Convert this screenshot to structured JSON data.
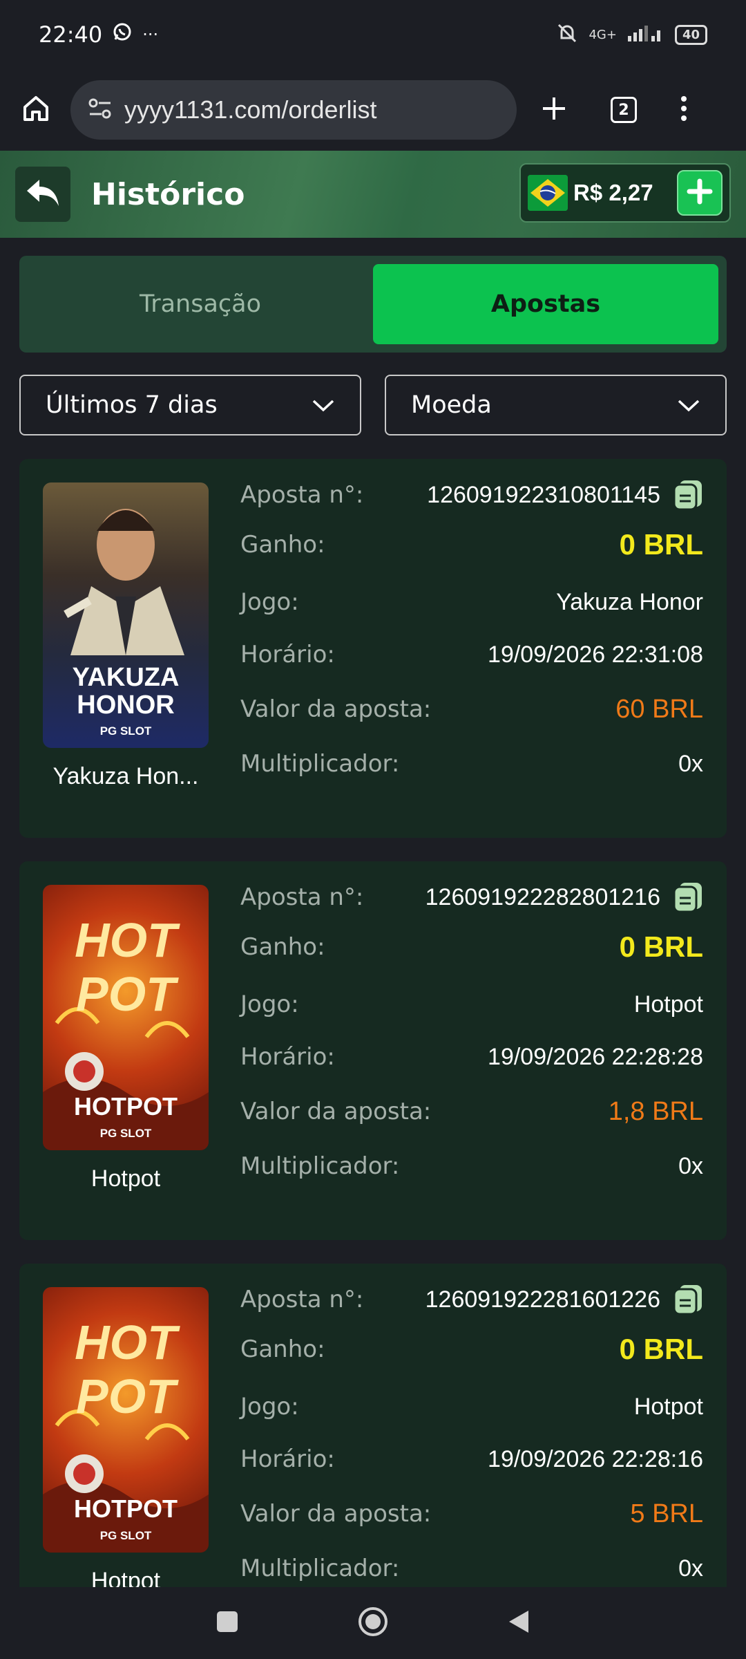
{
  "status_bar": {
    "time": "22:40",
    "more": "···",
    "network": "4G+",
    "battery": "40"
  },
  "browser": {
    "url": "yyyy1131.com/orderlist",
    "tab_count": "2"
  },
  "header": {
    "title": "Histórico",
    "balance": "R$ 2,27"
  },
  "tabs": [
    {
      "label": "Transação",
      "active": false
    },
    {
      "label": "Apostas",
      "active": true
    }
  ],
  "filters": {
    "period": "Últimos 7 dias",
    "currency": "Moeda"
  },
  "labels": {
    "bet_no": "Aposta n°:",
    "win": "Ganho:",
    "game": "Jogo:",
    "time": "Horário:",
    "bet_value": "Valor da aposta:",
    "multiplier": "Multiplicador:"
  },
  "bets": [
    {
      "thumb_title_1": "YAKUZA",
      "thumb_title_2": "HONOR",
      "thumb_brand": "PG SLOT",
      "caption": "Yakuza Hon...",
      "bet_no": "126091922310801145",
      "win": "0 BRL",
      "game": "Yakuza Honor",
      "time": "19/09/2026 22:31:08",
      "bet_value": "60 BRL",
      "multiplier": "0x"
    },
    {
      "thumb_title_1": "HOT",
      "thumb_title_2": "POT",
      "thumb_logo": "HOTPOT",
      "thumb_brand": "PG SLOT",
      "caption": "Hotpot",
      "bet_no": "126091922282801216",
      "win": "0 BRL",
      "game": "Hotpot",
      "time": "19/09/2026 22:28:28",
      "bet_value": "1,8 BRL",
      "multiplier": "0x"
    },
    {
      "thumb_title_1": "HOT",
      "thumb_title_2": "POT",
      "thumb_logo": "HOTPOT",
      "thumb_brand": "PG SLOT",
      "caption": "Hotpot",
      "bet_no": "126091922281601226",
      "win": "0 BRL",
      "game": "Hotpot",
      "time": "19/09/2026 22:28:16",
      "bet_value": "5 BRL",
      "multiplier": "0x"
    }
  ],
  "colors": {
    "accent_green": "#0cc24f",
    "win_yellow": "#f3e91c",
    "bet_orange": "#f07a18",
    "card_bg": "#162a21"
  }
}
